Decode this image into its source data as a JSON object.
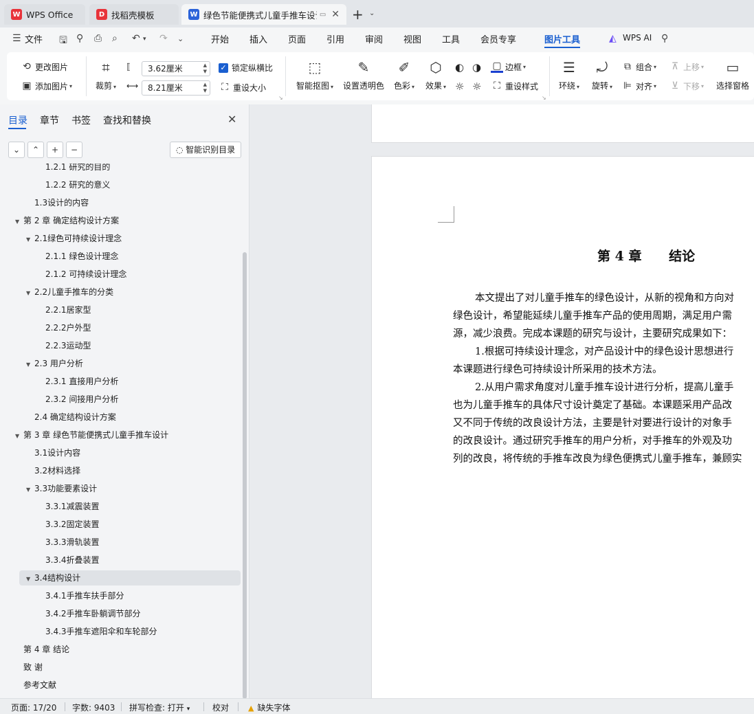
{
  "tabs": [
    {
      "label": "WPS Office",
      "icon": "wps-logo-icon"
    },
    {
      "label": "找稻壳模板",
      "icon": "docer-icon"
    },
    {
      "label": "绿色节能便携式儿童手推车设计",
      "icon": "word-doc-icon"
    }
  ],
  "menu": {
    "file": "文件",
    "items": [
      "开始",
      "插入",
      "页面",
      "引用",
      "审阅",
      "视图",
      "工具",
      "会员专享"
    ],
    "active": "图片工具",
    "wps_ai": "WPS AI"
  },
  "ribbon": {
    "change_image": "更改图片",
    "add_image": "添加图片",
    "crop": "裁剪",
    "width_value": "3.62厘米",
    "height_value": "8.21厘米",
    "lock_ratio": "锁定纵横比",
    "reset_size": "重设大小",
    "smart_cutout": "智能抠图",
    "set_transparent": "设置透明色",
    "color": "色彩",
    "effects": "效果",
    "border": "边框",
    "reset_style": "重设样式",
    "wrap": "环绕",
    "rotate": "旋转",
    "group": "组合",
    "align": "对齐",
    "move_up": "上移",
    "move_down": "下移",
    "selection_pane": "选择窗格"
  },
  "sidebar": {
    "tabs": [
      "目录",
      "章节",
      "书签",
      "查找和替换"
    ],
    "smart_toc": "智能识别目录",
    "toc": [
      {
        "text": "1.2.1  研究的目的",
        "level": 3
      },
      {
        "text": "1.2.2  研究的意义",
        "level": 3
      },
      {
        "text": "1.3设计的内容",
        "level": 2
      },
      {
        "text": "第 2 章  确定结构设计方案",
        "level": 1,
        "expanded": true
      },
      {
        "text": "2.1绿色可持续设计理念",
        "level": 2,
        "expanded": true
      },
      {
        "text": "2.1.1  绿色设计理念",
        "level": 3
      },
      {
        "text": "2.1.2  可持续设计理念",
        "level": 3
      },
      {
        "text": "2.2儿童手推车的分类",
        "level": 2,
        "expanded": true
      },
      {
        "text": "2.2.1居家型",
        "level": 3
      },
      {
        "text": "2.2.2户外型",
        "level": 3
      },
      {
        "text": "2.2.3运动型",
        "level": 3
      },
      {
        "text": "2.3  用户分析",
        "level": 2,
        "expanded": true
      },
      {
        "text": "2.3.1  直接用户分析",
        "level": 3
      },
      {
        "text": "2.3.2  间接用户分析",
        "level": 3
      },
      {
        "text": "2.4  确定结构设计方案",
        "level": 2
      },
      {
        "text": "第 3 章  绿色节能便携式儿童手推车设计",
        "level": 1,
        "expanded": true
      },
      {
        "text": "3.1设计内容",
        "level": 2
      },
      {
        "text": "3.2材料选择",
        "level": 2
      },
      {
        "text": "3.3功能要素设计",
        "level": 2,
        "expanded": true
      },
      {
        "text": "3.3.1减震装置",
        "level": 3
      },
      {
        "text": "3.3.2固定装置",
        "level": 3
      },
      {
        "text": "3.3.3滑轨装置",
        "level": 3
      },
      {
        "text": "3.3.4折叠装置",
        "level": 3
      },
      {
        "text": "3.4结构设计",
        "level": 2,
        "expanded": true,
        "selected": true
      },
      {
        "text": "3.4.1手推车扶手部分",
        "level": 3
      },
      {
        "text": "3.4.2手推车卧躺调节部分",
        "level": 3
      },
      {
        "text": "3.4.3手推车遮阳伞和车轮部分",
        "level": 3
      },
      {
        "text": "第 4 章  结论",
        "level": 1
      },
      {
        "text": "致  谢",
        "level": 1
      },
      {
        "text": "参考文献",
        "level": 1
      }
    ]
  },
  "document": {
    "chapter_title": "第 4 章      结论",
    "lines": [
      "本文提出了对儿童手推车的绿色设计，从新的视角和方向对",
      "绿色设计，希望能延续儿童手推车产品的使用周期，满足用户需",
      "源，减少浪费。完成本课题的研究与设计，主要研究成果如下：",
      "1.根据可持续设计理念，对产品设计中的绿色设计思想进行",
      "本课题进行绿色可持续设计所采用的技术方法。",
      "2.从用户需求角度对儿童手推车设计进行分析，提高儿童手",
      "也为儿童手推车的具体尺寸设计奠定了基础。本课题采用产品改",
      "又不同于传统的改良设计方法，主要是针对要进行设计的对象手",
      "的改良设计。通过研究手推车的用户分析，对手推车的外观及功",
      "列的改良，将传统的手推车改良为绿色便携式儿童手推车，兼顾实"
    ]
  },
  "status": {
    "page": "页面: 17/20",
    "words": "字数: 9403",
    "spell": "拼写检查: 打开",
    "proof": "校对",
    "missing_font": "缺失字体"
  }
}
